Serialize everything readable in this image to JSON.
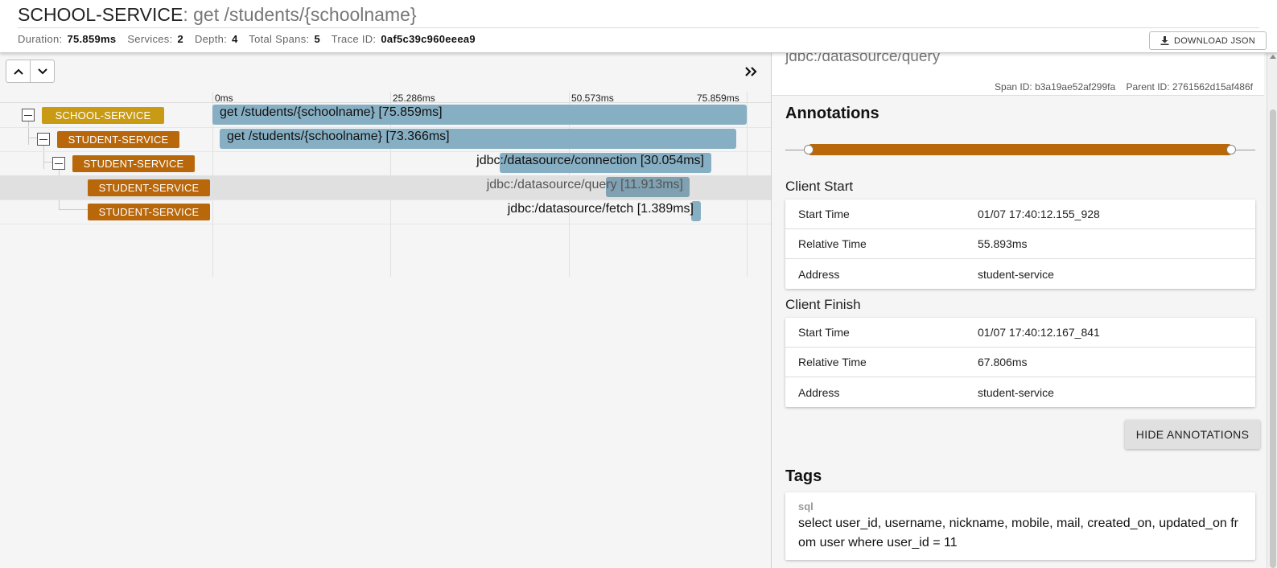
{
  "header": {
    "service_name": "SCHOOL-SERVICE",
    "span_name": ": get /students/{schoolname}",
    "stats": {
      "duration_label": "Duration:",
      "duration": "75.859ms",
      "services_label": "Services:",
      "services": "2",
      "depth_label": "Depth:",
      "depth": "4",
      "total_spans_label": "Total Spans:",
      "total_spans": "5",
      "trace_id_label": "Trace ID:",
      "trace_id": "0af5c39c960eeea9"
    },
    "download_label": "DOWNLOAD JSON"
  },
  "timeline": {
    "ticks": [
      "0ms",
      "25.286ms",
      "50.573ms",
      "75.859ms"
    ],
    "total_ms": 75.859
  },
  "spans": [
    {
      "service": "SCHOOL-SERVICE",
      "label": "get /students/{schoolname} [75.859ms]",
      "start_ms": 0,
      "duration_ms": 75.859,
      "depth": 0,
      "collapsible": true,
      "selected": false
    },
    {
      "service": "STUDENT-SERVICE",
      "label": "get /students/{schoolname} [73.366ms]",
      "start_ms": 1.0,
      "duration_ms": 73.366,
      "depth": 1,
      "collapsible": true,
      "selected": false
    },
    {
      "service": "STUDENT-SERVICE",
      "label": "jdbc:/datasource/connection [30.054ms]",
      "start_ms": 40.8,
      "duration_ms": 30.054,
      "depth": 2,
      "collapsible": true,
      "selected": false
    },
    {
      "service": "STUDENT-SERVICE",
      "label": "jdbc:/datasource/query [11.913ms]",
      "start_ms": 55.893,
      "duration_ms": 11.913,
      "depth": 3,
      "collapsible": false,
      "selected": true
    },
    {
      "service": "STUDENT-SERVICE",
      "label": "jdbc:/datasource/fetch [1.389ms]",
      "start_ms": 68.0,
      "duration_ms": 1.389,
      "depth": 3,
      "collapsible": false,
      "selected": false
    }
  ],
  "detail": {
    "span_name": "jdbc:/datasource/query",
    "span_id_label": "Span ID:",
    "span_id": "b3a19ae52af299fa",
    "parent_id_label": "Parent ID:",
    "parent_id": "2761562d15af486f",
    "annotations_title": "Annotations",
    "client_start": {
      "title": "Client Start",
      "rows": [
        {
          "key": "Start Time",
          "value": "01/07 17:40:12.155_928"
        },
        {
          "key": "Relative Time",
          "value": "55.893ms"
        },
        {
          "key": "Address",
          "value": "student-service"
        }
      ]
    },
    "client_finish": {
      "title": "Client Finish",
      "rows": [
        {
          "key": "Start Time",
          "value": "01/07 17:40:12.167_841"
        },
        {
          "key": "Relative Time",
          "value": "67.806ms"
        },
        {
          "key": "Address",
          "value": "student-service"
        }
      ]
    },
    "hide_annotations_label": "HIDE ANNOTATIONS",
    "tags_title": "Tags",
    "tags": [
      {
        "key": "sql",
        "value": "select user_id, username, nickname, mobile, mail, created_on, updated_on from user where user_id = 11"
      }
    ]
  },
  "colors": {
    "school_service": "#c99a14",
    "student_service": "#b8670a",
    "span_bar": "#87afc3",
    "annotation_bar": "#b8670a"
  }
}
